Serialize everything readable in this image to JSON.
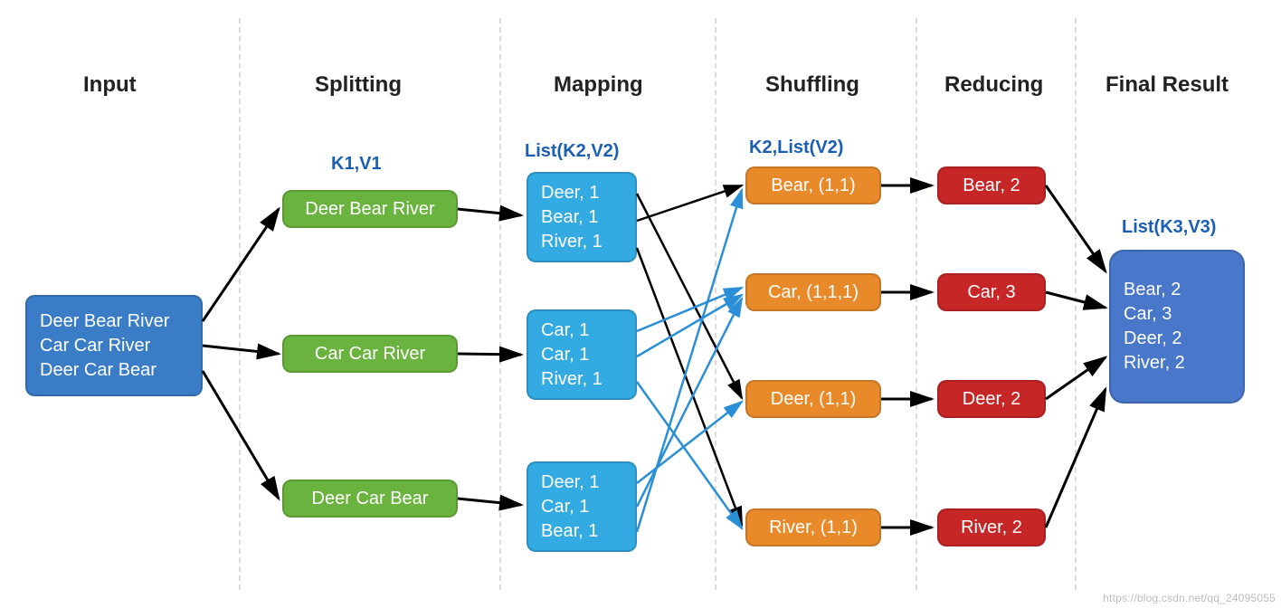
{
  "headers": {
    "input": "Input",
    "splitting": "Splitting",
    "mapping": "Mapping",
    "shuffling": "Shuffling",
    "reducing": "Reducing",
    "final": "Final Result"
  },
  "labels": {
    "k1v1": "K1,V1",
    "listk2v2": "List(K2,V2)",
    "k2listv2": "K2,List(V2)",
    "listk3v3": "List(K3,V3)"
  },
  "input": {
    "line1": "Deer Bear River",
    "line2": "Car Car River",
    "line3": "Deer Car Bear"
  },
  "split": {
    "s1": "Deer Bear River",
    "s2": "Car Car River",
    "s3": "Deer Car Bear"
  },
  "map": {
    "m1": {
      "l1": "Deer, 1",
      "l2": "Bear, 1",
      "l3": "River, 1"
    },
    "m2": {
      "l1": "Car, 1",
      "l2": "Car, 1",
      "l3": "River, 1"
    },
    "m3": {
      "l1": "Deer, 1",
      "l2": "Car, 1",
      "l3": "Bear, 1"
    }
  },
  "shuffle": {
    "sh1": "Bear, (1,1)",
    "sh2": "Car, (1,1,1)",
    "sh3": "Deer, (1,1)",
    "sh4": "River, (1,1)"
  },
  "reduce": {
    "r1": "Bear, 2",
    "r2": "Car, 3",
    "r3": "Deer, 2",
    "r4": "River, 2"
  },
  "final": {
    "l1": "Bear, 2",
    "l2": "Car, 3",
    "l3": "Deer, 2",
    "l4": "River, 2"
  },
  "watermark": "https://blog.csdn.net/qq_24095055"
}
